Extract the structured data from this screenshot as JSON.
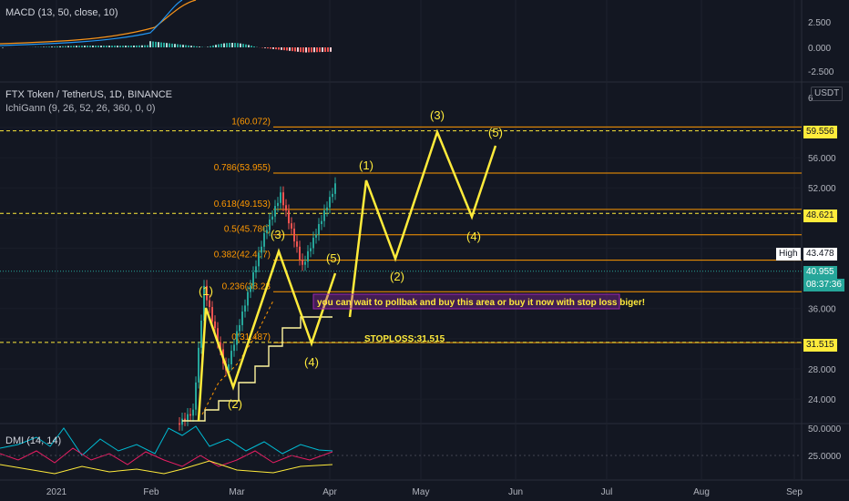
{
  "panes": {
    "macd": {
      "title": "MACD (13, 50, close, 10)",
      "scale": [
        "2.500",
        "0.000",
        "-2.500"
      ]
    },
    "main": {
      "symbol": "FTX Token / TetherUS, 1D, BINANCE",
      "indicator": "IchiGann (9, 26, 52, 26, 360, 0, 0)",
      "currency": "USDT",
      "scale": [
        "60.000",
        "56.000",
        "52.000",
        "48.000",
        "44.000",
        "40.000",
        "36.000",
        "32.000",
        "28.000",
        "24.000"
      ],
      "scale_top": "6"
    },
    "dmi": {
      "title": "DMI (14, 14)",
      "scale": [
        "50.0000",
        "25.0000",
        "0.0000"
      ]
    }
  },
  "time_axis": [
    "2021",
    "Feb",
    "Mar",
    "Apr",
    "May",
    "Jun",
    "Jul",
    "Aug",
    "Sep"
  ],
  "price_tags": {
    "resistance": {
      "value": "59.556",
      "color": "#ffeb3b"
    },
    "mid": {
      "value": "48.621",
      "color": "#ffeb3b"
    },
    "high_label": "High",
    "high": {
      "value": "43.478",
      "color": "#ffffff"
    },
    "last": {
      "value": "40.955",
      "color": "#26a69a"
    },
    "countdown": "08:37:36",
    "stop": {
      "value": "31.515",
      "color": "#ffeb3b"
    }
  },
  "fib_levels": [
    {
      "label": "1(60.072)",
      "price": 60.072
    },
    {
      "label": "0.786(53.955)",
      "price": 53.955
    },
    {
      "label": "0.618(49.153)",
      "price": 49.153
    },
    {
      "label": "0.5(45.780)",
      "price": 45.78
    },
    {
      "label": "0.382(42.407)",
      "price": 42.407
    },
    {
      "label": "0.236(38.23",
      "price": 38.23
    },
    {
      "label": "0(31.487)",
      "price": 31.487
    }
  ],
  "wave_labels_small": [
    "(1)",
    "(2)",
    "(3)",
    "(4)",
    "(5)"
  ],
  "wave_labels_big": [
    "(1)",
    "(2)",
    "(3)",
    "(4)",
    "(5)"
  ],
  "annotation": "you  can wait to pollbak and buy this area or buy it now with stop loss biger!",
  "stoploss_label": "STOPLOSS:31.515",
  "colors": {
    "bg": "#131722",
    "fib": "#ff9800",
    "wave": "#ffeb3b",
    "up": "#26a69a",
    "down": "#ef5350",
    "annot": "#9c27b0"
  }
}
